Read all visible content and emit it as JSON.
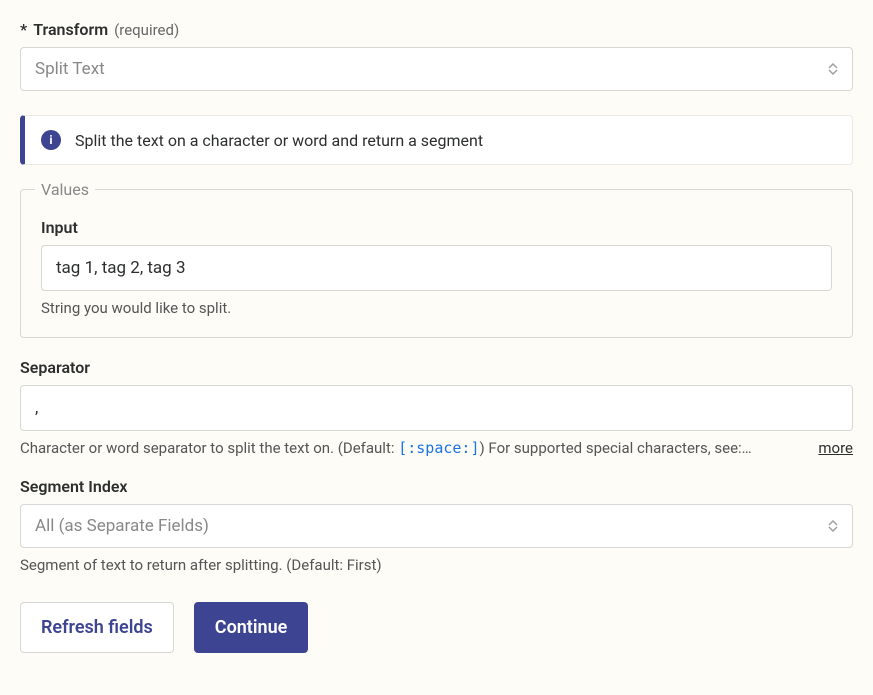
{
  "transform": {
    "asterisk": "*",
    "label": "Transform",
    "required": "(required)",
    "value": "Split Text"
  },
  "info": {
    "icon_text": "i",
    "text": "Split the text on a character or word and return a segment"
  },
  "values": {
    "legend": "Values",
    "input": {
      "label": "Input",
      "value": "tag 1, tag 2, tag 3",
      "help": "String you would like to split."
    }
  },
  "separator": {
    "label": "Separator",
    "value": ",",
    "help_prefix": "Character or word separator to split the text on. (Default: ",
    "help_code": "[:space:]",
    "help_suffix": ") For supported special characters, see:…",
    "more": "more"
  },
  "segment": {
    "label": "Segment Index",
    "value": "All (as Separate Fields)",
    "help": "Segment of text to return after splitting. (Default: First)"
  },
  "buttons": {
    "refresh": "Refresh fields",
    "continue": "Continue"
  }
}
